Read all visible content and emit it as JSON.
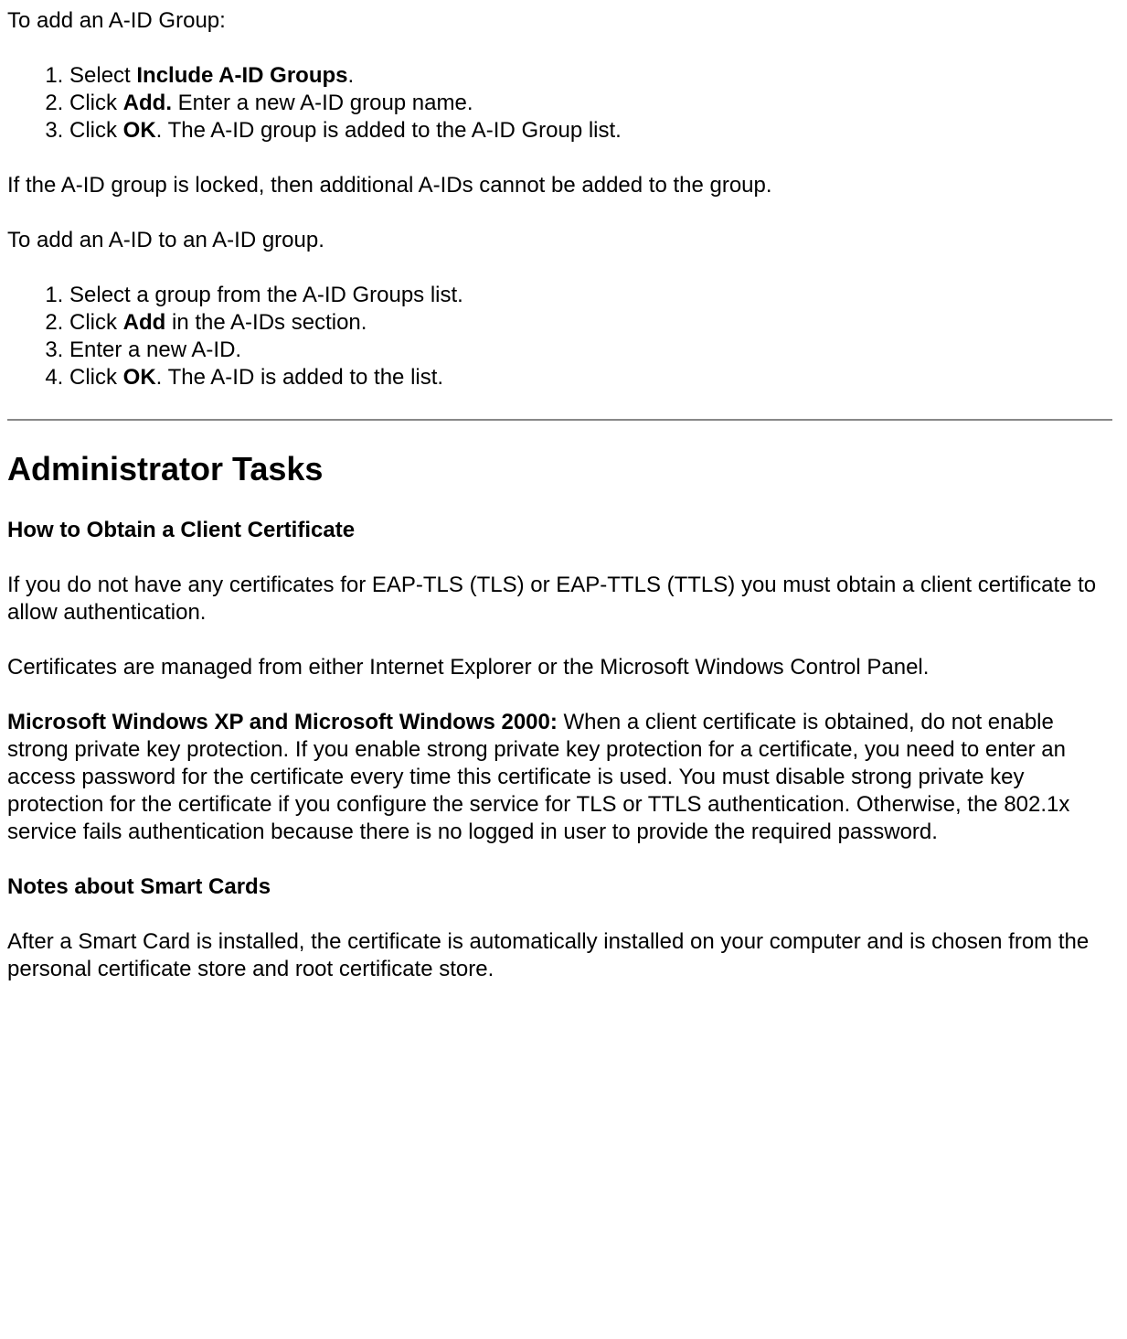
{
  "intro1": "To add an A-ID Group:",
  "list1": {
    "item1_pre": "Select ",
    "item1_bold": "Include A-ID Groups",
    "item1_post": ".",
    "item2_pre": "Click ",
    "item2_bold": "Add.",
    "item2_post": " Enter a new A-ID group name.",
    "item3_pre": "Click ",
    "item3_bold": "OK",
    "item3_post": ". The A-ID group is added to the A-ID Group list."
  },
  "locked_note": "If the A-ID group is locked, then additional A-IDs cannot be added to the group.",
  "intro2": "To add an A-ID to an A-ID group.",
  "list2": {
    "item1": "Select a group from the A-ID Groups list.",
    "item2_pre": "Click ",
    "item2_bold": "Add",
    "item2_post": " in the A-IDs section.",
    "item3": "Enter a new A-ID.",
    "item4_pre": "Click ",
    "item4_bold": "OK",
    "item4_post": ". The A-ID is added to the list."
  },
  "heading_admin": "Administrator Tasks",
  "heading_cert": "How to Obtain a Client Certificate",
  "cert_p1": "If you do not have any certificates for EAP-TLS (TLS) or EAP-TTLS (TTLS) you must obtain a client certificate to allow authentication.",
  "cert_p2": "Certificates are managed from either Internet Explorer or the Microsoft Windows Control Panel.",
  "cert_p3_bold": "Microsoft Windows XP and Microsoft Windows 2000:",
  "cert_p3_post": " When a client certificate is obtained, do not enable strong private key protection. If you enable strong private key protection for a certificate, you need to enter an access password for the certificate every time this certificate is used. You must disable strong private key protection for the certificate if you configure the service for TLS or TTLS authentication. Otherwise, the 802.1x service fails authentication because there is no logged in user to provide the required password.",
  "heading_smart": "Notes about Smart Cards",
  "smart_p1": "After a Smart Card is installed, the certificate is automatically installed on your computer and is chosen from the personal certificate store and root certificate store."
}
